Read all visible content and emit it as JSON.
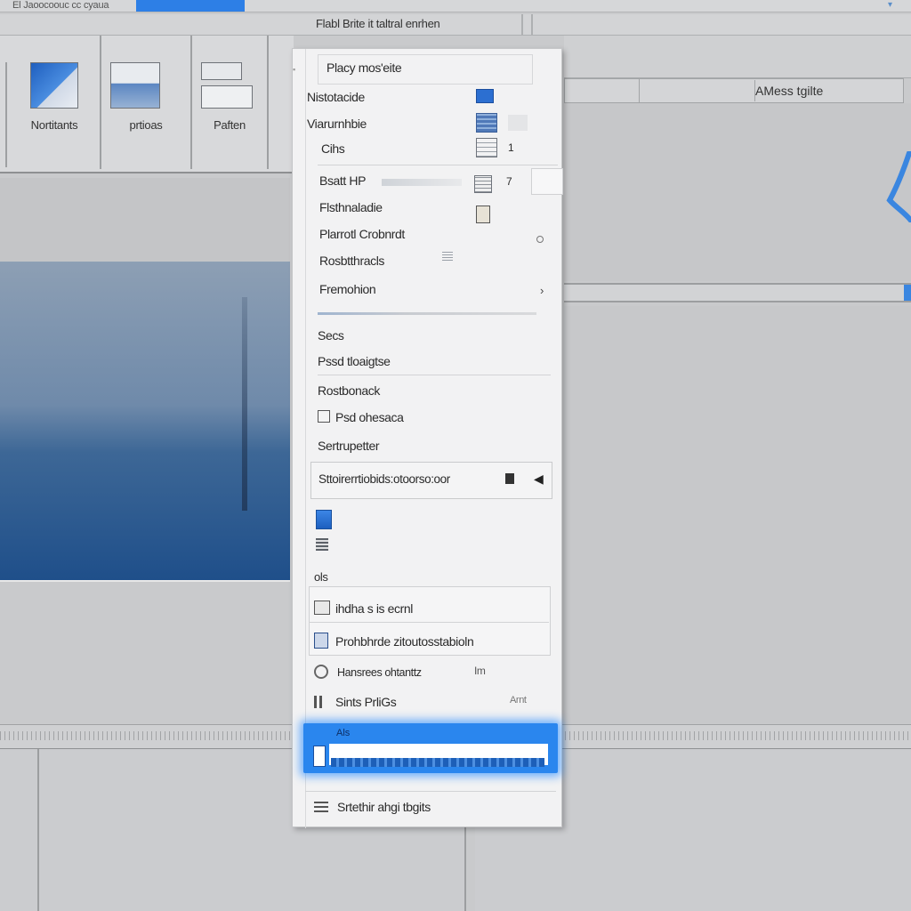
{
  "window": {
    "top_title": "El Jaoocoouc cc cyaua",
    "title_bar": "Flabl Brite it taltral enrhen"
  },
  "ribbon": {
    "groups": [
      {
        "label": "Nortitants"
      },
      {
        "label": "prtioas"
      },
      {
        "label": "Paften"
      }
    ]
  },
  "right_panel": {
    "header_button": "AMess tgilte"
  },
  "menu": {
    "title": "Placy mos'eite",
    "items_group1": [
      {
        "label": "Nistotacide"
      },
      {
        "label": "Viarurnhbie"
      },
      {
        "label": "Cihs",
        "shortcut": "1"
      }
    ],
    "items_group2": [
      {
        "label": "Bsatt HP",
        "shortcut": "7"
      },
      {
        "label": "Flsthnaladie"
      },
      {
        "label": "Plarrotl Crobnrdt"
      },
      {
        "label": "Rosbtthracls"
      },
      {
        "label": "Fremohion"
      }
    ],
    "items_group3": [
      {
        "label": "Secs"
      },
      {
        "label": "Pssd tloaigtse"
      }
    ],
    "items_group4": [
      {
        "label": "Rostbonack"
      },
      {
        "label": "Psd ohesaca"
      },
      {
        "label": "Sertrupetter"
      }
    ],
    "submenu_item": "Sttoirerrtiobids:otoorso:oor",
    "small_label": "ols",
    "items_group5": [
      {
        "label": "ihdha s is ecrnl"
      },
      {
        "label": "Prohbhrde zitoutosstabioln"
      },
      {
        "label": "Hansrees ohtanttz",
        "shortcut": "Im"
      },
      {
        "label": "Sints PrliGs",
        "shortcut": "Arnt"
      }
    ],
    "highlighted_label": "Als",
    "footer_item": "Srtethir ahgi tbgits"
  }
}
